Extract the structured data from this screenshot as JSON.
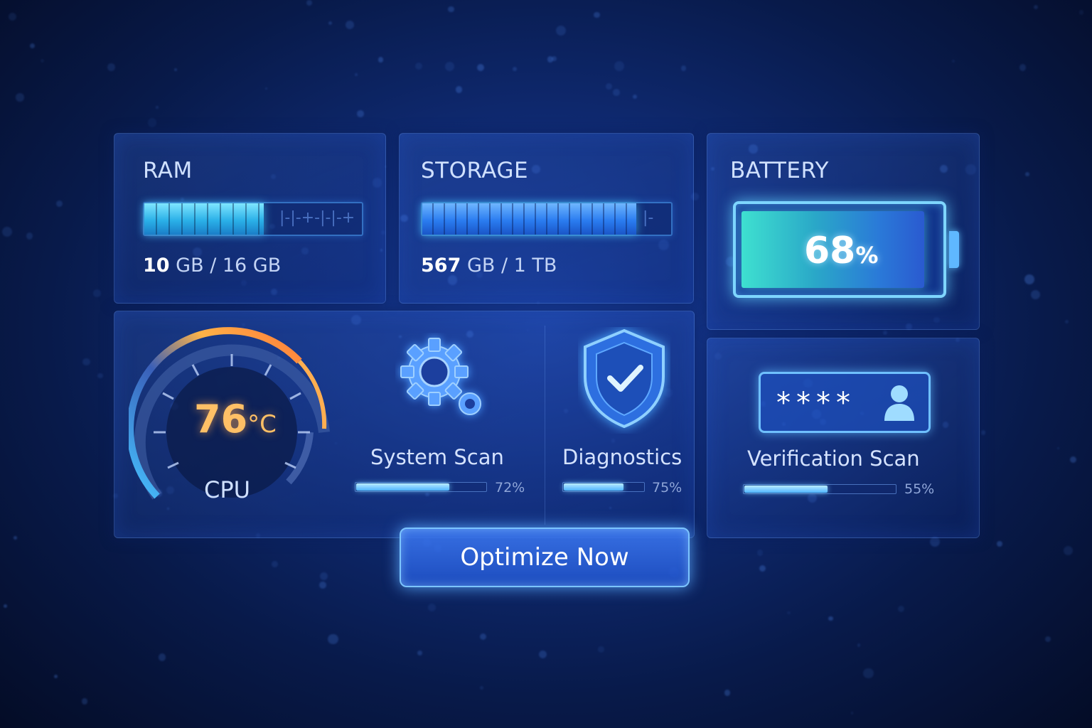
{
  "ram": {
    "title": "RAM",
    "used": "10",
    "rest": " GB / 16 GB",
    "fraction": 0.55
  },
  "storage": {
    "title": "STORAGE",
    "used": "567",
    "rest": " GB / 1 TB",
    "fraction": 0.86
  },
  "battery": {
    "title": "BATTERY",
    "value": "68",
    "unit": "%",
    "fraction": 0.68
  },
  "cpu": {
    "temp": "76",
    "unit": "°C",
    "label": "CPU"
  },
  "system_scan": {
    "label": "System Scan",
    "percent": "72%",
    "fraction": 0.72
  },
  "diagnostics": {
    "label": "Diagnostics",
    "percent": "75%",
    "fraction": 0.75
  },
  "verification": {
    "label": "Verification Scan",
    "percent": "55%",
    "fraction": 0.55,
    "password_mask": "****"
  },
  "optimize_button": {
    "label": "Optimize Now"
  },
  "colors": {
    "accent": "#4fb4ff",
    "cpu_orange": "#ffb347",
    "background": "#0f2a72"
  },
  "icons": [
    "gear-icon",
    "shield-check-icon",
    "user-icon",
    "battery-icon",
    "gauge-icon"
  ]
}
